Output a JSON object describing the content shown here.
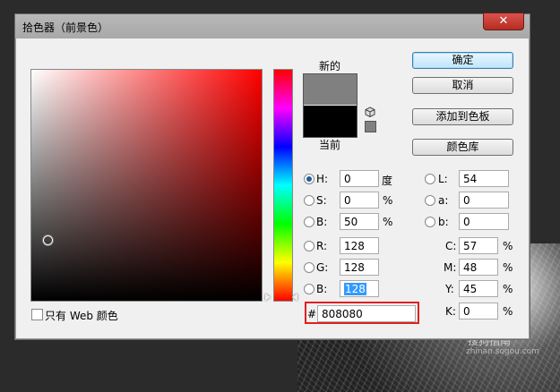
{
  "dialog": {
    "title": "拾色器（前景色）",
    "close_symbol": "✕"
  },
  "preview": {
    "new_label": "新的",
    "current_label": "当前",
    "new_color": "#808080",
    "current_color": "#000000"
  },
  "buttons": {
    "ok": "确定",
    "cancel": "取消",
    "add_to_swatches": "添加到色板",
    "color_libraries": "颜色库"
  },
  "hsb": [
    {
      "key": "H:",
      "value": "0",
      "unit": "度",
      "selected": true
    },
    {
      "key": "S:",
      "value": "0",
      "unit": "%",
      "selected": false
    },
    {
      "key": "B:",
      "value": "50",
      "unit": "%",
      "selected": false
    }
  ],
  "rgb": [
    {
      "key": "R:",
      "value": "128"
    },
    {
      "key": "G:",
      "value": "128"
    },
    {
      "key": "B:",
      "value": "128"
    }
  ],
  "lab": [
    {
      "key": "L:",
      "value": "54"
    },
    {
      "key": "a:",
      "value": "0"
    },
    {
      "key": "b:",
      "value": "0"
    }
  ],
  "cmyk": [
    {
      "key": "C:",
      "value": "57",
      "unit": "%"
    },
    {
      "key": "M:",
      "value": "48",
      "unit": "%"
    },
    {
      "key": "Y:",
      "value": "45",
      "unit": "%"
    },
    {
      "key": "K:",
      "value": "0",
      "unit": "%"
    }
  ],
  "hex": {
    "prefix": "#",
    "value": "808080"
  },
  "web_only": {
    "label": "只有 Web 颜色",
    "checked": false
  },
  "watermark": {
    "text": "搜狗指南",
    "url": "zhinan.sogou.com"
  },
  "colors": {
    "highlight_border": "#e02020",
    "selection": "#3399ff"
  }
}
